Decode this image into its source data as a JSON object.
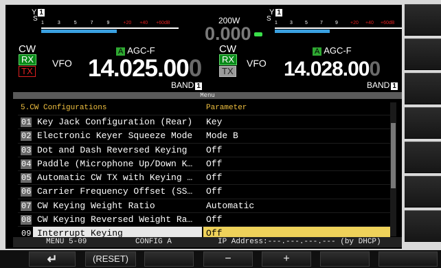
{
  "left": {
    "ant": "Y",
    "ant_num": "1",
    "meter_ticks": [
      "S",
      "1",
      "3",
      "5",
      "7",
      "9",
      "+20",
      "+40",
      "+60dB"
    ],
    "mode": "CW",
    "rx": "RX",
    "tx": "TX",
    "vfo": "VFO",
    "agc_a": "A",
    "agc": "AGC-F",
    "freq_main": "14.025.00",
    "freq_dim": "0",
    "band": "BAND",
    "band_num": "1"
  },
  "center": {
    "power": "200W",
    "value": "0.000"
  },
  "right": {
    "ant": "Y",
    "ant_num": "1",
    "meter_ticks": [
      "S",
      "1",
      "3",
      "5",
      "7",
      "9",
      "+20",
      "+40",
      "+60dB"
    ],
    "mode": "CW",
    "rx": "RX",
    "tx": "TX",
    "vfo": "VFO",
    "agc_a": "A",
    "agc": "AGC-F",
    "freq_main": "14.028.00",
    "freq_dim": "0",
    "band": "BAND",
    "band_num": "1"
  },
  "menu": {
    "title": "Menu",
    "col_group": "5.CW Configurations",
    "col_param": "Parameter",
    "items": [
      {
        "num": "01",
        "label": "Key Jack Configuration (Rear)",
        "value": "Key"
      },
      {
        "num": "02",
        "label": "Electronic Keyer Squeeze Mode",
        "value": "Mode B"
      },
      {
        "num": "03",
        "label": "Dot and Dash Reversed Keying",
        "value": "Off"
      },
      {
        "num": "04",
        "label": "Paddle (Microphone Up/Down K…",
        "value": "Off"
      },
      {
        "num": "05",
        "label": "Automatic CW TX with Keying …",
        "value": "Off"
      },
      {
        "num": "06",
        "label": "Carrier Frequency Offset (SS…",
        "value": "Off"
      },
      {
        "num": "07",
        "label": "CW Keying Weight Ratio",
        "value": "Automatic"
      },
      {
        "num": "08",
        "label": "CW Keying Reversed Weight Ra…",
        "value": "Off"
      },
      {
        "num": "09",
        "label": "Interrupt Keying",
        "value": "Off"
      }
    ]
  },
  "status": {
    "menu": "MENU 5-09",
    "config": "CONFIG A",
    "ip": "IP Address:---.---.---.--- (by DHCP)"
  },
  "softkeys": {
    "back": "↵",
    "reset": "(RESET)",
    "minus": "−",
    "plus": "+"
  },
  "colors": {
    "accent": "#efd25a",
    "rx": "#0a8a1a",
    "tx": "#e02020",
    "meter": "#3aa0e0"
  }
}
